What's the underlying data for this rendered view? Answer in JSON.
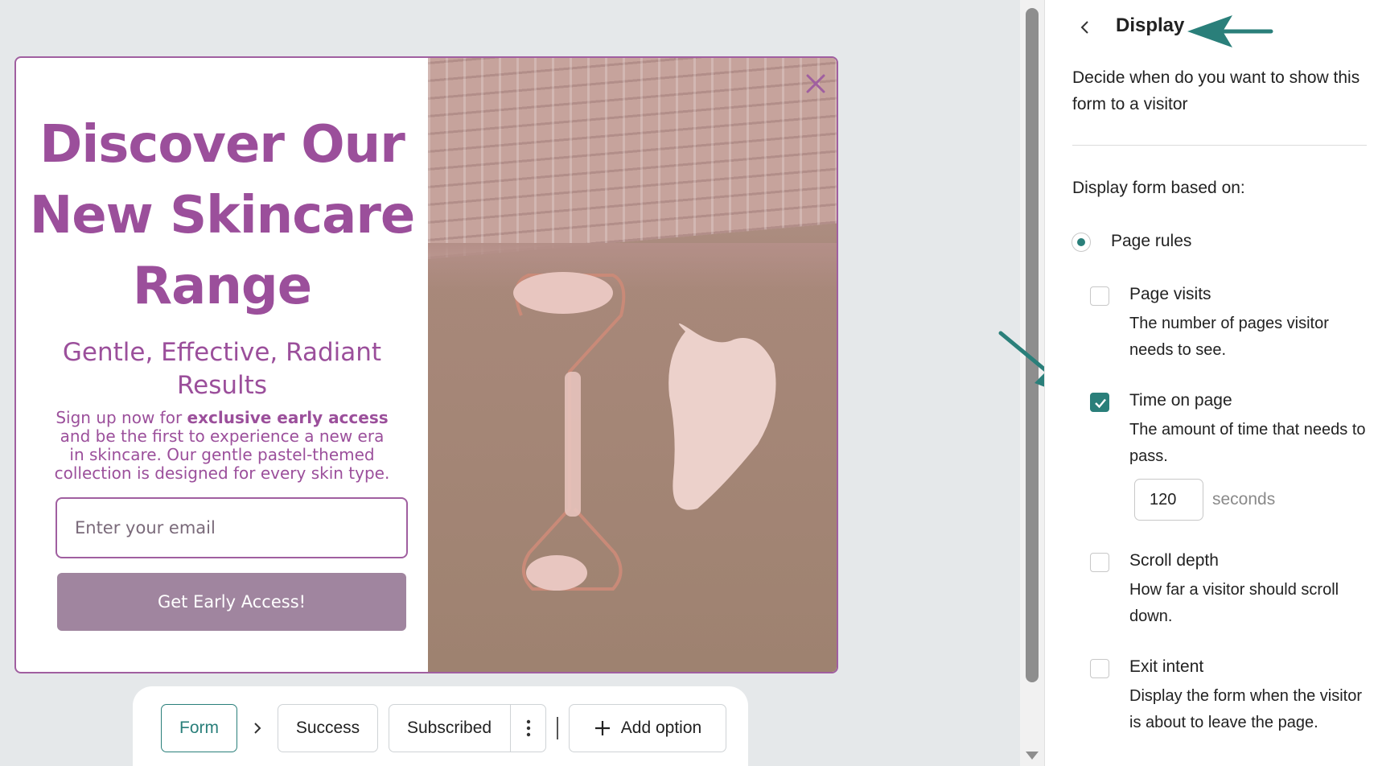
{
  "popup": {
    "headline": "Discover Our New Skincare Range",
    "subheadline": "Gentle, Effective, Radiant Results",
    "body_prefix": "Sign up now for ",
    "body_bold": "exclusive early access",
    "body_suffix": " and be the first to experience a new era in skincare. Our gentle pastel-themed collection is designed for every skin type.",
    "email_placeholder": "Enter your email",
    "cta_label": "Get Early Access!",
    "image_icon": "jade-roller-gua-sha-photo",
    "close_icon": "close-icon"
  },
  "steps": {
    "form": "Form",
    "success": "Success",
    "subscribed": "Subscribed",
    "add_option": "Add option"
  },
  "panel": {
    "title": "Display",
    "description": "Decide when do you want to show this form to a visitor",
    "based_on": "Display form based on:",
    "radio_label": "Page rules",
    "rules": [
      {
        "title": "Page visits",
        "description": "The number of pages visitor needs to see.",
        "checked": false
      },
      {
        "title": "Time on page",
        "description": "The amount of time that needs to pass.",
        "checked": true
      },
      {
        "title": "Scroll depth",
        "description": "How far a visitor should scroll down.",
        "checked": false
      },
      {
        "title": "Exit intent",
        "description": "Display the form when the visitor is about to leave the page.",
        "checked": false
      }
    ],
    "time_value": "120",
    "time_unit": "seconds"
  },
  "colors": {
    "brand_purple": "#9b4f9b",
    "cta_mauve": "#a0859f",
    "accent_teal": "#2a7f7a"
  }
}
